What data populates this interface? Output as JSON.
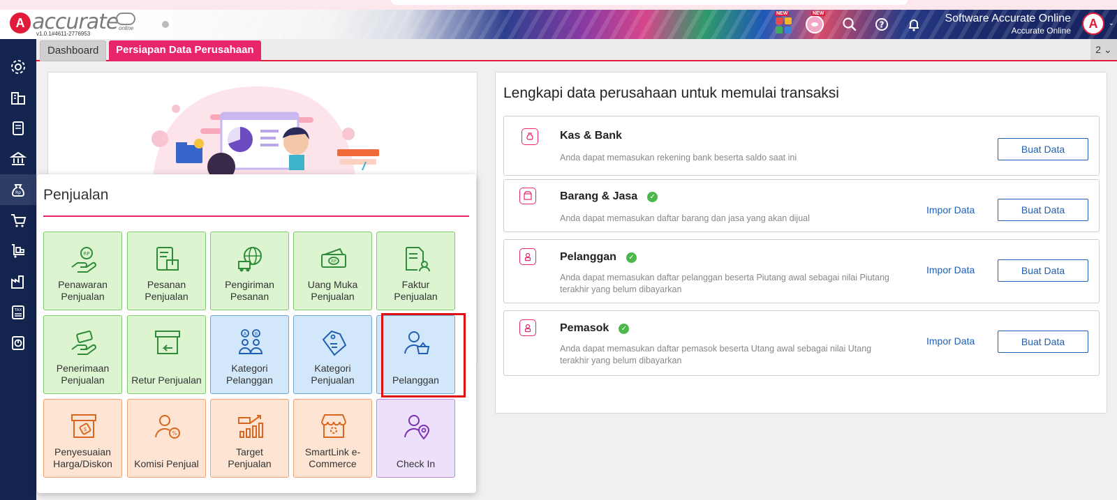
{
  "header": {
    "logo_text": "accurate",
    "logo_online": "online",
    "version": "v1.0.1#4611-2776953",
    "new_badge": "NEW",
    "company_name": "Software Accurate Online",
    "company_sub": "Accurate Online"
  },
  "tabs": {
    "dashboard": "Dashboard",
    "persiapan": "Persiapan Data Perusahaan",
    "count": "2 ⌄"
  },
  "overlay": {
    "title": "Penjualan",
    "tiles": [
      {
        "label": "Penawaran Penjualan",
        "icon": "hand-money-icon",
        "color": "green"
      },
      {
        "label": "Pesanan Penjualan",
        "icon": "document-box-icon",
        "color": "green"
      },
      {
        "label": "Pengiriman Pesanan",
        "icon": "globe-truck-icon",
        "color": "green"
      },
      {
        "label": "Uang Muka Penjualan",
        "icon": "cash-stack-icon",
        "color": "green"
      },
      {
        "label": "Faktur Penjualan",
        "icon": "invoice-person-icon",
        "color": "green"
      },
      {
        "label": "Penerimaan Penjualan",
        "icon": "hand-cash-icon",
        "color": "green"
      },
      {
        "label": "Retur Penjualan",
        "icon": "box-return-icon",
        "color": "green"
      },
      {
        "label": "Kategori Pelanggan",
        "icon": "people-category-icon",
        "color": "blue"
      },
      {
        "label": "Kategori Penjualan",
        "icon": "tag-icon",
        "color": "blue"
      },
      {
        "label": "Pelanggan",
        "icon": "person-basket-icon",
        "color": "blue"
      },
      {
        "label": "Penyesuaian Harga/Diskon",
        "icon": "price-box-icon",
        "color": "orange"
      },
      {
        "label": "Komisi Penjual",
        "icon": "person-percent-icon",
        "color": "orange"
      },
      {
        "label": "Target Penjualan",
        "icon": "growth-chart-icon",
        "color": "orange"
      },
      {
        "label": "SmartLink e-Commerce",
        "icon": "store-gear-icon",
        "color": "orange"
      },
      {
        "label": "Check In",
        "icon": "person-location-icon",
        "color": "purple"
      }
    ]
  },
  "setup": {
    "title": "Lengkapi data perusahaan untuk memulai transaksi",
    "impor_label": "Impor Data",
    "buat_label": "Buat Data",
    "cards": [
      {
        "title": "Kas & Bank",
        "desc": "Anda dapat memasukan rekening bank beserta saldo saat ini",
        "done": false,
        "impor": false
      },
      {
        "title": "Barang & Jasa",
        "desc": "Anda dapat memasukan daftar barang dan jasa yang akan dijual",
        "done": true,
        "impor": true
      },
      {
        "title": "Pelanggan",
        "desc": "Anda dapat memasukan daftar pelanggan beserta Piutang awal sebagai nilai Piutang terakhir yang belum dibayarkan",
        "done": true,
        "impor": true
      },
      {
        "title": "Pemasok",
        "desc": "Anda dapat memasukan daftar pemasok beserta Utang awal sebagai nilai Utang terakhir yang belum dibayarkan",
        "done": true,
        "impor": true
      }
    ]
  },
  "colors": {
    "brand": "#e11b3a",
    "accent": "#e8256a",
    "sidebar": "#13244f",
    "link": "#1f5fb3",
    "check": "#4cb84c"
  }
}
